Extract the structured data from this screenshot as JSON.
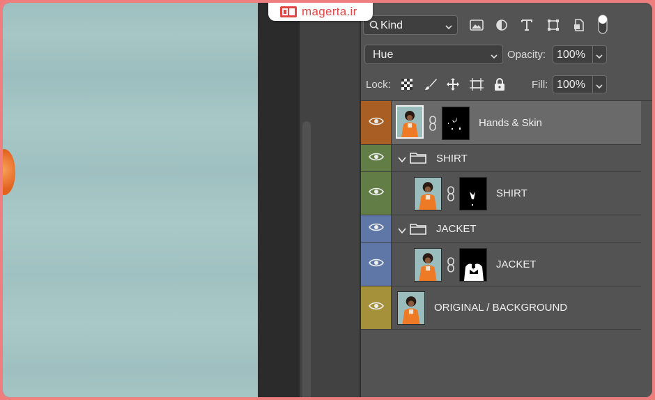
{
  "watermark": {
    "text": "magerta.ir"
  },
  "filter_bar": {
    "kind_label": "Kind",
    "icons": [
      "image-filter-icon",
      "adjustment-filter-icon",
      "type-filter-icon",
      "shape-filter-icon",
      "smart-object-filter-icon",
      "filter-toggle-icon"
    ]
  },
  "blend": {
    "mode": "Hue",
    "opacity_label": "Opacity:",
    "opacity_value": "100%"
  },
  "lock": {
    "label": "Lock:",
    "icons": [
      "lock-transparent-pixels-icon",
      "lock-image-pixels-icon",
      "lock-position-icon",
      "lock-artboard-icon",
      "lock-all-icon"
    ],
    "fill_label": "Fill:",
    "fill_value": "100%"
  },
  "layers": [
    {
      "name": "Hands & Skin",
      "type": "layer",
      "color": "#a95f23",
      "selected": true
    },
    {
      "name": "SHIRT",
      "type": "group",
      "color": "#637d47"
    },
    {
      "name": "SHIRT",
      "type": "layer",
      "color": "#637d47"
    },
    {
      "name": "JACKET",
      "type": "group",
      "color": "#5f77a6"
    },
    {
      "name": "JACKET",
      "type": "layer",
      "color": "#5f77a6"
    },
    {
      "name": "ORIGINAL / BACKGROUND",
      "type": "layer",
      "color": "#a4913a"
    }
  ],
  "colors": {
    "accent": "#ef7e7e",
    "panel": "#535353",
    "selected_row": "#6a6a6a"
  }
}
